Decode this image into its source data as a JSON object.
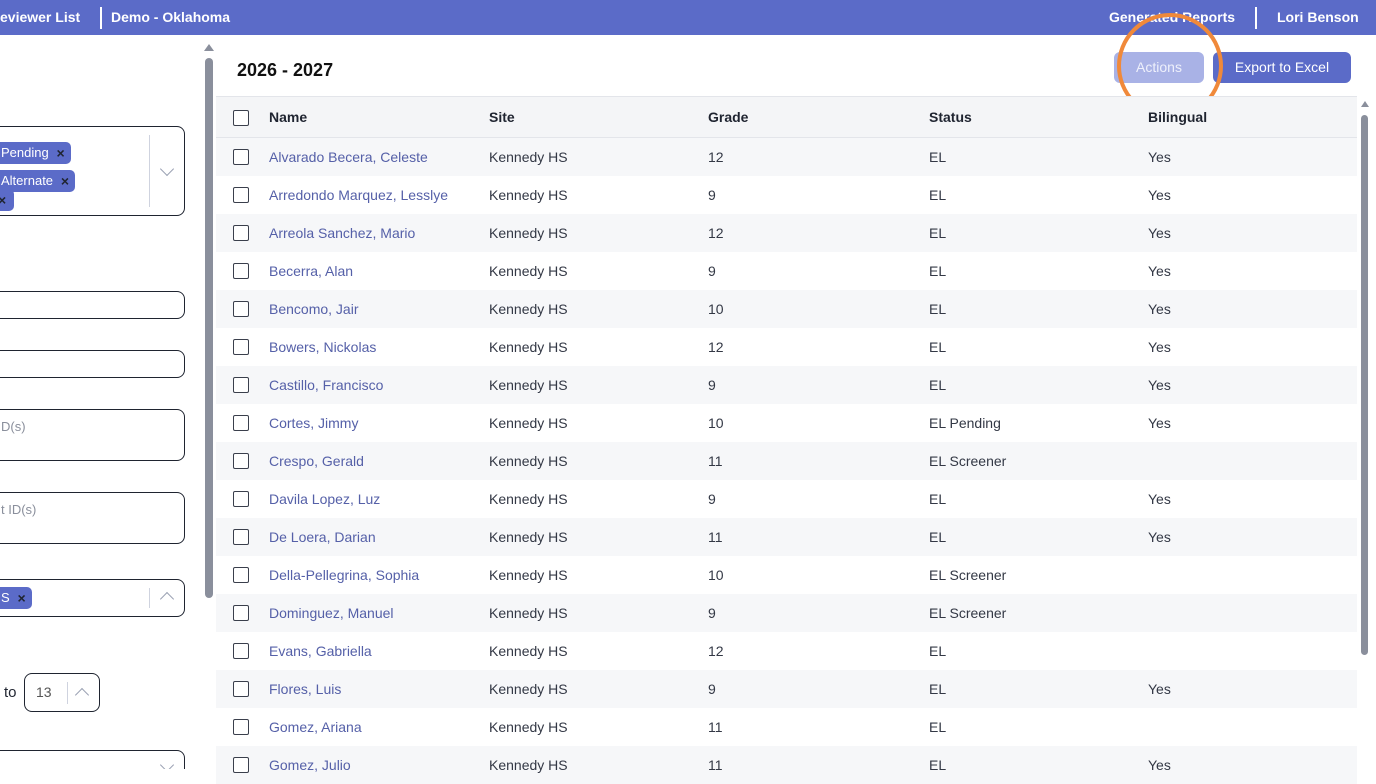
{
  "topbar": {
    "reviewer_list": "eviewer List",
    "district": "Demo - Oklahoma",
    "generated_reports": "Generated Reports",
    "user": "Lori Benson"
  },
  "filters": {
    "status_chips": [
      "Pending",
      "Alternate",
      ""
    ],
    "id_placeholder_1": "D(s)",
    "id_placeholder_2": "t ID(s)",
    "site_chip": "S",
    "to_label": "to",
    "grade_to_value": "13"
  },
  "main": {
    "year": "2026 - 2027",
    "actions_label": "Actions",
    "export_label": "Export to Excel"
  },
  "table": {
    "headers": {
      "name": "Name",
      "site": "Site",
      "grade": "Grade",
      "status": "Status",
      "bilingual": "Bilingual"
    },
    "rows": [
      {
        "name": "Alvarado Becera, Celeste",
        "site": "Kennedy HS",
        "grade": "12",
        "status": "EL",
        "bilingual": "Yes"
      },
      {
        "name": "Arredondo Marquez, Lesslye",
        "site": "Kennedy HS",
        "grade": "9",
        "status": "EL",
        "bilingual": "Yes"
      },
      {
        "name": "Arreola Sanchez, Mario",
        "site": "Kennedy HS",
        "grade": "12",
        "status": "EL",
        "bilingual": "Yes"
      },
      {
        "name": "Becerra, Alan",
        "site": "Kennedy HS",
        "grade": "9",
        "status": "EL",
        "bilingual": "Yes"
      },
      {
        "name": "Bencomo, Jair",
        "site": "Kennedy HS",
        "grade": "10",
        "status": "EL",
        "bilingual": "Yes"
      },
      {
        "name": "Bowers, Nickolas",
        "site": "Kennedy HS",
        "grade": "12",
        "status": "EL",
        "bilingual": "Yes"
      },
      {
        "name": "Castillo, Francisco",
        "site": "Kennedy HS",
        "grade": "9",
        "status": "EL",
        "bilingual": "Yes"
      },
      {
        "name": "Cortes, Jimmy",
        "site": "Kennedy HS",
        "grade": "10",
        "status": "EL Pending",
        "bilingual": "Yes"
      },
      {
        "name": "Crespo, Gerald",
        "site": "Kennedy HS",
        "grade": "11",
        "status": "EL Screener",
        "bilingual": ""
      },
      {
        "name": "Davila Lopez, Luz",
        "site": "Kennedy HS",
        "grade": "9",
        "status": "EL",
        "bilingual": "Yes"
      },
      {
        "name": "De Loera, Darian",
        "site": "Kennedy HS",
        "grade": "11",
        "status": "EL",
        "bilingual": "Yes"
      },
      {
        "name": "Della-Pellegrina, Sophia",
        "site": "Kennedy HS",
        "grade": "10",
        "status": "EL Screener",
        "bilingual": ""
      },
      {
        "name": "Dominguez, Manuel",
        "site": "Kennedy HS",
        "grade": "9",
        "status": "EL Screener",
        "bilingual": ""
      },
      {
        "name": "Evans, Gabriella",
        "site": "Kennedy HS",
        "grade": "12",
        "status": "EL",
        "bilingual": ""
      },
      {
        "name": "Flores, Luis",
        "site": "Kennedy HS",
        "grade": "9",
        "status": "EL",
        "bilingual": "Yes"
      },
      {
        "name": "Gomez, Ariana",
        "site": "Kennedy HS",
        "grade": "11",
        "status": "EL",
        "bilingual": ""
      },
      {
        "name": "Gomez, Julio",
        "site": "Kennedy HS",
        "grade": "11",
        "status": "EL",
        "bilingual": "Yes"
      }
    ]
  },
  "colors": {
    "brand": "#5b6bc8",
    "actions_disabled": "#a9b2e6",
    "highlight_ring": "#f0893a",
    "name_link": "#5560a8"
  },
  "icons": [
    "close-icon",
    "chevron-down-icon",
    "chevron-up-icon",
    "checkbox-icon",
    "scroll-up-arrow-icon"
  ]
}
